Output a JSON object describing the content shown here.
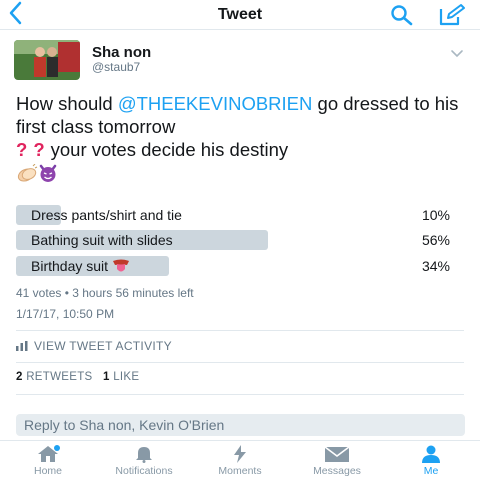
{
  "navbar": {
    "title": "Tweet",
    "back_icon": "chevron-left-icon",
    "search_icon": "search-icon",
    "compose_icon": "compose-icon",
    "accent": "#1da1f2"
  },
  "author": {
    "name": "Sha non",
    "handle": "@staub7",
    "avatar_icon": "avatar-photo"
  },
  "tweet": {
    "text_before": "How should ",
    "mention": "@THEEKEVINOBRIEN",
    "text_after": " go dressed to his first class tomorrow",
    "qmark1": "?",
    "qmark2": "?",
    "text_line3": "your votes decide his destiny",
    "emojis": [
      "clapping-hands-emoji",
      "smiling-devil-emoji"
    ]
  },
  "poll": {
    "options": [
      {
        "label": "Dress pants/shirt and tie",
        "percent_text": "10%",
        "fraction": 0.1
      },
      {
        "label": "Bathing suit with slides",
        "percent_text": "56%",
        "fraction": 0.56
      },
      {
        "label": "Birthday suit",
        "percent_text": "34%",
        "fraction": 0.34,
        "emoji": "tongue-emoji"
      }
    ],
    "meta": "41 votes • 3 hours 56 minutes left"
  },
  "timestamp": "1/17/17, 10:50 PM",
  "activity": {
    "label": "VIEW TWEET ACTIVITY",
    "icon": "bar-chart-icon"
  },
  "stats": {
    "retweets_count": "2",
    "retweets_label": "RETWEETS",
    "likes_count": "1",
    "likes_label": "LIKE"
  },
  "reply": {
    "placeholder": "Reply to Sha non, Kevin O'Brien"
  },
  "tabs": [
    {
      "label": "Home",
      "icon": "home-icon",
      "active": false
    },
    {
      "label": "Notifications",
      "icon": "bell-icon",
      "active": false
    },
    {
      "label": "Moments",
      "icon": "lightning-icon",
      "active": false
    },
    {
      "label": "Messages",
      "icon": "envelope-icon",
      "active": false
    },
    {
      "label": "Me",
      "icon": "person-icon",
      "active": true
    }
  ],
  "colors": {
    "accent": "#1da1f2",
    "poll_bar": "#ccd6dd",
    "secondary_text": "#657786"
  }
}
